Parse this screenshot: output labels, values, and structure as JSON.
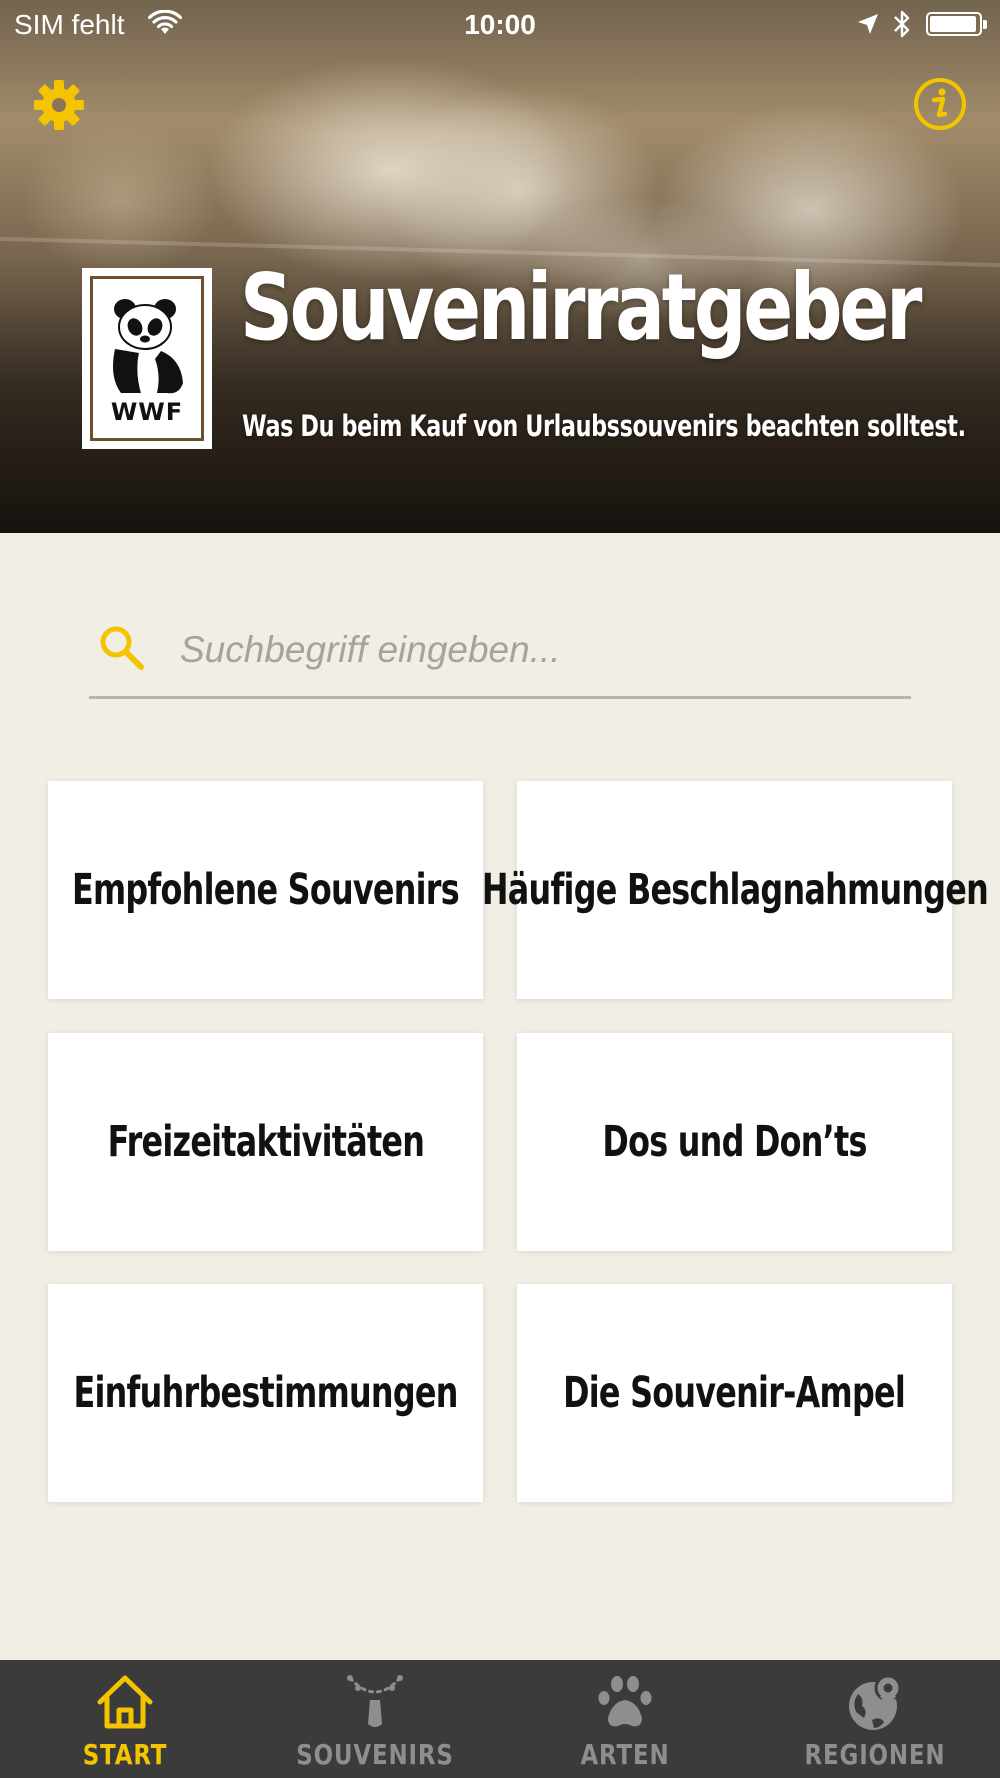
{
  "status_bar": {
    "carrier": "SIM fehlt",
    "time": "10:00"
  },
  "header": {
    "title": "Souvenirratgeber",
    "subtitle": "Was Du beim Kauf von Urlaubssouvenirs beachten solltest.",
    "logo_text": "WWF",
    "settings_icon": "gear-icon",
    "info_icon": "info-icon"
  },
  "search": {
    "placeholder": "Suchbegriff eingeben...",
    "value": ""
  },
  "tiles": [
    {
      "label": "Empfohlene Souvenirs"
    },
    {
      "label": "Häufige Beschlagnahmungen"
    },
    {
      "label": "Freizeitaktivitäten"
    },
    {
      "label": "Dos und Don’ts"
    },
    {
      "label": "Einfuhrbestimmungen"
    },
    {
      "label": "Die Souvenir-Ampel"
    }
  ],
  "tab_bar": {
    "tabs": [
      {
        "label": "START",
        "icon": "home-icon",
        "active": true
      },
      {
        "label": "SOUVENIRS",
        "icon": "necklace-icon",
        "active": false
      },
      {
        "label": "ARTEN",
        "icon": "paw-icon",
        "active": false
      },
      {
        "label": "REGIONEN",
        "icon": "globe-pin-icon",
        "active": false
      }
    ]
  },
  "colors": {
    "accent": "#f5c400",
    "background": "#f1eee6",
    "tab_bar": "#3b3b3b",
    "tab_inactive": "#8e8e8e"
  }
}
